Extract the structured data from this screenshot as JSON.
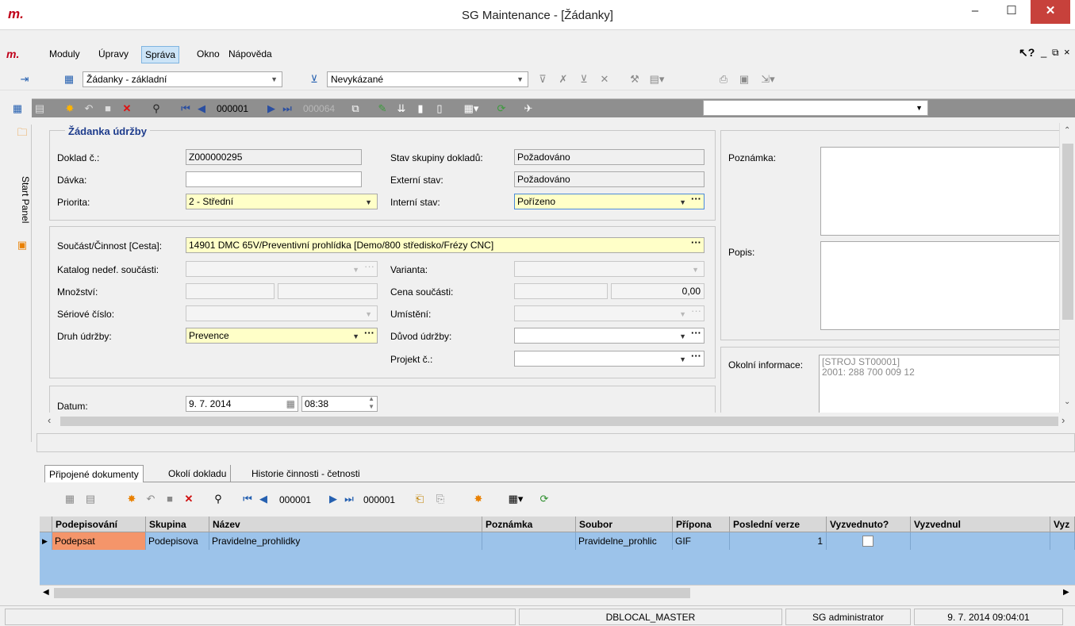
{
  "window": {
    "title": "SG Maintenance - [Žádanky]",
    "logo": "m.",
    "minimize": "–",
    "maximize": "☐",
    "close": "✕"
  },
  "menu": {
    "logo": "m.",
    "items": [
      "Moduly",
      "Úpravy",
      "Správa",
      "Okno",
      "Nápověda"
    ],
    "active_index": 2,
    "right_controls": "?",
    "right_min": "_",
    "right_restore": "ð",
    "right_close": "×"
  },
  "toolbar": {
    "view_combo": "Žádanky - základní",
    "filter_combo": "Nevykázané"
  },
  "navigator": {
    "current": "000001",
    "total": "000064"
  },
  "side_panel": {
    "label": "Start Panel"
  },
  "form": {
    "group_title": "Žádanka údržby",
    "doklad_label": "Doklad č.:",
    "doklad_value": "Z000000295",
    "davka_label": "Dávka:",
    "davka_value": "",
    "priorita_label": "Priorita:",
    "priorita_value": "2 - Střední",
    "stav_skupiny_label": "Stav skupiny dokladů:",
    "stav_skupiny_value": "Požadováno",
    "externi_stav_label": "Externí stav:",
    "externi_stav_value": "Požadováno",
    "interni_stav_label": "Interní stav:",
    "interni_stav_value": "Pořízeno",
    "soucast_label": "Součást/Činnost [Cesta]:",
    "soucast_value": "14901 DMC 65V/Preventivní prohlídka [Demo/800 středisko/Frézy CNC]",
    "katalog_label": "Katalog nedef. součásti:",
    "varianta_label": "Varianta:",
    "mnozstvi_label": "Množství:",
    "cena_label": "Cena součásti:",
    "cena_value": "0,00",
    "seriove_label": "Sériové číslo:",
    "umisteni_label": "Umístění:",
    "druh_label": "Druh údržby:",
    "druh_value": "Prevence",
    "duvod_label": "Důvod údržby:",
    "projekt_label": "Projekt č.:",
    "datum_label": "Datum:",
    "datum_value": "9. 7. 2014",
    "cas_value": "08:38",
    "poznamka_label": "Poznámka:",
    "popis_label": "Popis:",
    "okolni_label": "Okolní informace:",
    "okolni_line1": "[STROJ ST00001]",
    "okolni_line2": "2001: 288 700 009 12"
  },
  "tabs": [
    "Připojené dokumenty",
    "Okolí dokladu",
    "Historie činnosti - četnosti"
  ],
  "sub_navigator": {
    "current": "000001",
    "total": "000001"
  },
  "grid": {
    "columns": [
      "Podepisování",
      "Skupina",
      "Název",
      "Poznámka",
      "Soubor",
      "Přípona",
      "Poslední verze",
      "Vyzvednuto?",
      "Vyzvednul",
      "Vyz"
    ],
    "rows": [
      {
        "podepisovani": "Podepsat",
        "skupina": "Podepisova",
        "nazev": "Pravidelne_prohlidky",
        "poznamka": "",
        "soubor": "Pravidelne_prohlic",
        "pripona": "GIF",
        "posledni_verze": "1",
        "vyzvednul": ""
      }
    ]
  },
  "status": {
    "database": "DBLOCAL_MASTER",
    "user": "SG administrator",
    "datetime": "9. 7. 2014 09:04:01"
  },
  "colors": {
    "accent": "#c0001a",
    "close_button": "#c7413b",
    "required_field": "#ffffc8",
    "selected_row": "#9cc3ea",
    "signing_cell": "#f4956a",
    "navbar": "#8f8f8f"
  }
}
